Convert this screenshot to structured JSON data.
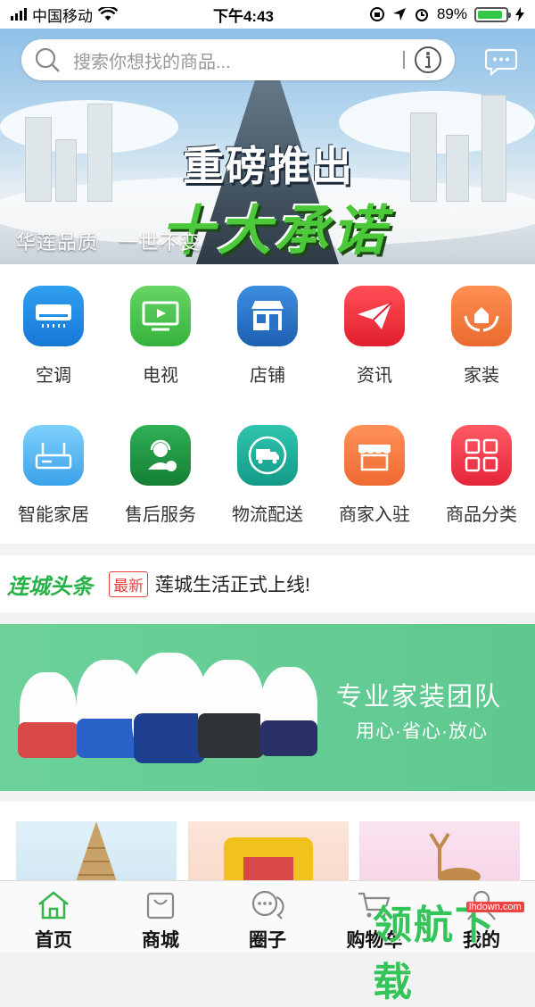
{
  "statusbar": {
    "carrier": "中国移动",
    "time": "下午4:43",
    "battery": "89%",
    "battery_level": 0.89
  },
  "search": {
    "placeholder": "搜索你想找的商品..."
  },
  "banner": {
    "headline_1": "重磅推出",
    "headline_2": "十大承诺",
    "slogan": "华莲品质　一世不变"
  },
  "categories": [
    {
      "label": "空调",
      "icon": "air-conditioner-icon",
      "color": "#1f8ee6"
    },
    {
      "label": "电视",
      "icon": "tv-icon",
      "color": "#4cc74f"
    },
    {
      "label": "店铺",
      "icon": "store-icon",
      "color": "#2b73c9"
    },
    {
      "label": "资讯",
      "icon": "paper-plane-icon",
      "color": "#f0343d"
    },
    {
      "label": "家装",
      "icon": "house-hands-icon",
      "color": "#f47d40"
    },
    {
      "label": "智能家居",
      "icon": "router-icon",
      "color": "#57b4ef"
    },
    {
      "label": "售后服务",
      "icon": "support-agent-icon",
      "color": "#1f9a42"
    },
    {
      "label": "物流配送",
      "icon": "delivery-truck-icon",
      "color": "#1bb19d"
    },
    {
      "label": "商家入驻",
      "icon": "shop-awning-icon",
      "color": "#f57f40"
    },
    {
      "label": "商品分类",
      "icon": "category-grid-icon",
      "color": "#f2354a"
    }
  ],
  "news": {
    "brand": "连城头条",
    "tag": "最新",
    "headline": "莲城生活正式上线!"
  },
  "promo": {
    "title": "专业家装团队",
    "subtitle": "用心·省心·放心"
  },
  "tabs": [
    {
      "label": "首页",
      "icon": "home-icon"
    },
    {
      "label": "商城",
      "icon": "shopping-bag-icon"
    },
    {
      "label": "圈子",
      "icon": "chat-bubbles-icon"
    },
    {
      "label": "购物车",
      "icon": "cart-icon"
    },
    {
      "label": "我的",
      "icon": "profile-icon"
    }
  ],
  "watermark": {
    "text": "领航下载",
    "site": "lhdown.com"
  },
  "colors": {
    "accent": "#27b248",
    "active_tab": "#35b44a"
  }
}
